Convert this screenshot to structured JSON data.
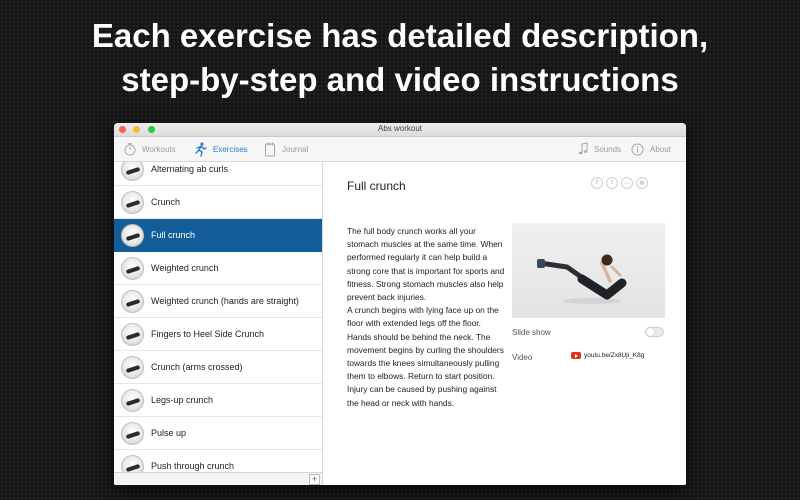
{
  "headline": {
    "line1": "Each exercise has detailed description,",
    "line2": "step-by-step and video instructions"
  },
  "window": {
    "title": "Abs workout"
  },
  "toolbar": {
    "workouts": "Workouts",
    "exercises": "Exercises",
    "journal": "Journal",
    "sounds": "Sounds",
    "about": "About",
    "accent_color": "#2a7ad3"
  },
  "sidebar": {
    "items": [
      {
        "label": "Alternating ab curls"
      },
      {
        "label": "Crunch"
      },
      {
        "label": "Full crunch",
        "selected": true
      },
      {
        "label": "Weighted crunch"
      },
      {
        "label": "Weighted crunch (hands are straight)"
      },
      {
        "label": "Fingers to Heel Side Crunch"
      },
      {
        "label": "Crunch (arms crossed)"
      },
      {
        "label": "Legs-up crunch"
      },
      {
        "label": "Pulse up"
      },
      {
        "label": "Push through crunch"
      }
    ],
    "selected_color": "#135d9b",
    "add_label": "+"
  },
  "detail": {
    "title": "Full crunch",
    "share_icons": [
      "facebook-icon",
      "twitter-icon",
      "message-icon",
      "email-icon"
    ],
    "share_glyphs": [
      "f",
      "t",
      "…",
      "✉"
    ],
    "description_p1": "The full body crunch works all your stomach muscles at the same time. When performed regularly it can help build a strong core that is important for sports and fitness. Strong stomach muscles also help prevent back injuries.",
    "description_p2": "A crunch begins with lying face up on the floor with extended legs off the floor. Hands should be behind the neck. The movement begins by curling the shoulders towards the knees simultaneously pulling them to elbows. Return to start position. Injury can be caused by pushing against the head or neck with hands.",
    "slideshow_label": "Slide show",
    "slideshow_on": false,
    "video_label": "Video",
    "video_link": "youtu.be/Zx8Uji_K8g"
  }
}
